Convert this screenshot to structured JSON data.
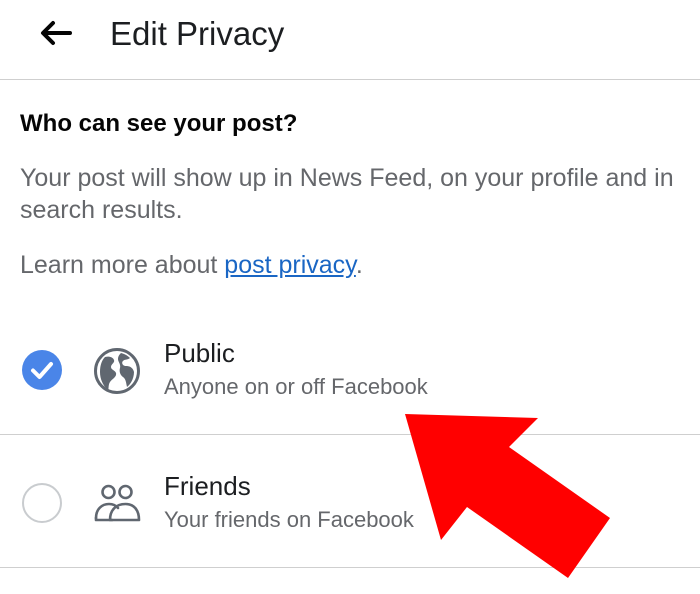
{
  "header": {
    "title": "Edit Privacy",
    "back_icon": "back-arrow-icon"
  },
  "content": {
    "heading": "Who can see your post?",
    "description": "Your post will show up in News Feed, on your profile and in search results.",
    "learn_more_prefix": "Learn more about ",
    "learn_more_link": "post privacy",
    "learn_more_suffix": "."
  },
  "options": [
    {
      "title": "Public",
      "subtitle": "Anyone on or off Facebook",
      "icon": "globe-icon",
      "selected": true
    },
    {
      "title": "Friends",
      "subtitle": "Your friends on Facebook",
      "icon": "friends-icon",
      "selected": false
    }
  ],
  "colors": {
    "accent": "#4a85e8",
    "link": "#1a66c4",
    "annotation_arrow": "#ff0000"
  }
}
